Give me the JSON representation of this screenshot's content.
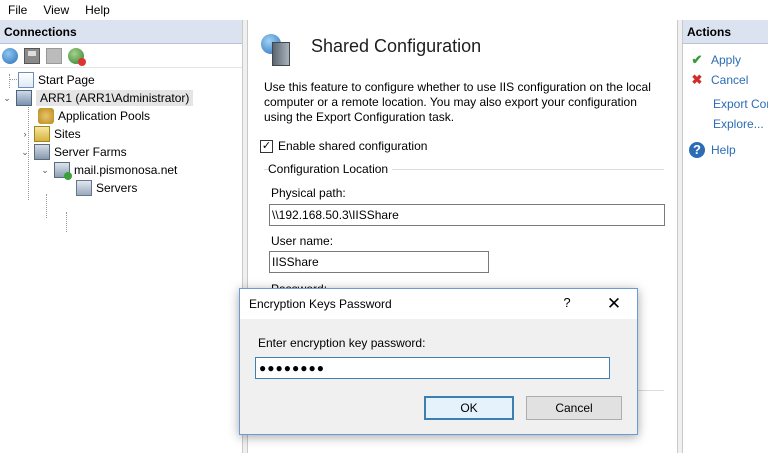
{
  "menu": {
    "file": "File",
    "view": "View",
    "help": "Help"
  },
  "connections": {
    "title": "Connections",
    "tree": {
      "start_page": "Start Page",
      "server": "ARR1 (ARR1\\Administrator)",
      "app_pools": "Application Pools",
      "sites": "Sites",
      "server_farms": "Server Farms",
      "farm": "mail.pismonosa.net",
      "servers": "Servers"
    }
  },
  "feature": {
    "title": "Shared Configuration",
    "description": "Use this feature to configure whether to use IIS configuration on the local computer or a remote location. You may also export your configuration using the Export Configuration task.",
    "enable_label": "Enable shared configuration",
    "enable_checked": true,
    "group_title": "Configuration Location",
    "physical_path_label": "Physical path:",
    "physical_path_value": "\\\\192.168.50.3\\IISShare",
    "user_name_label": "User name:",
    "user_name_value": "IISShare",
    "password_label": "Password:"
  },
  "actions": {
    "title": "Actions",
    "apply": "Apply",
    "cancel": "Cancel",
    "export": "Export Configuration...",
    "explore": "Explore...",
    "help": "Help"
  },
  "dialog": {
    "title": "Encryption Keys Password",
    "help_glyph": "?",
    "close_glyph": "✕",
    "prompt": "Enter encryption key password:",
    "password_value": "●●●●●●●●",
    "ok_label": "OK",
    "cancel_label": "Cancel"
  },
  "icons": {
    "checkmark": "✓",
    "apply": "✔",
    "cancel": "✖",
    "help": "?"
  }
}
